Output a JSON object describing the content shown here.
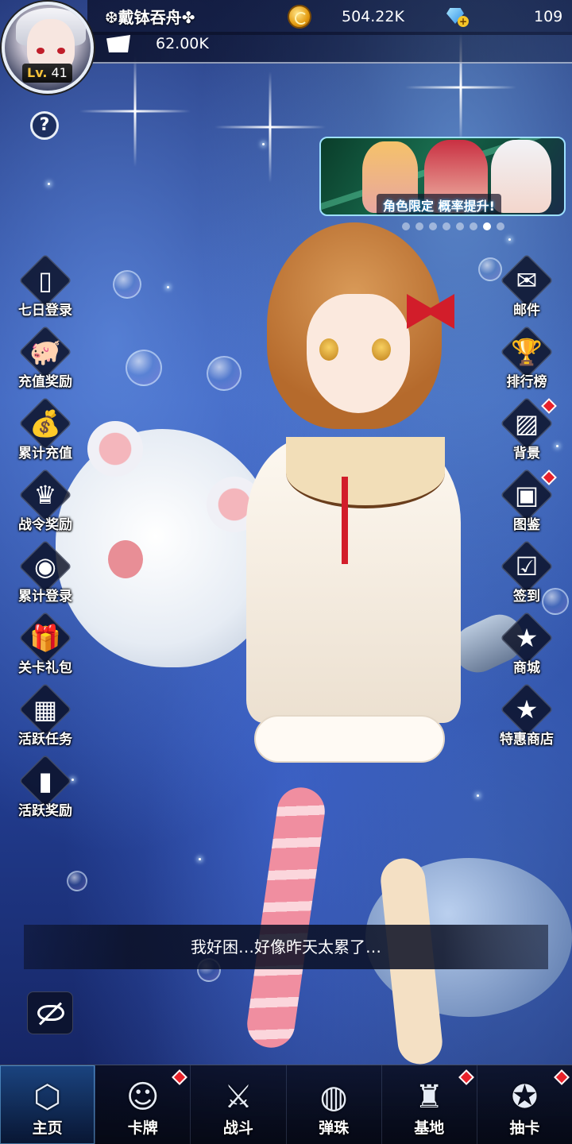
{
  "player": {
    "name": "❆戴钵吞舟✤",
    "level_prefix": "Lv.",
    "level": "41",
    "stamina": "62.00K"
  },
  "currency": {
    "coins": "504.22K",
    "gems": "109"
  },
  "help": {
    "label": "?"
  },
  "banner": {
    "text": "角色限定 概率提升!",
    "page_count": 8,
    "active_page": 7
  },
  "left_menu": [
    {
      "label": "七日登录",
      "icon": "phone-check-icon"
    },
    {
      "label": "充值奖励",
      "icon": "piggy-bank-icon"
    },
    {
      "label": "累计充值",
      "icon": "money-bag-icon"
    },
    {
      "label": "战令奖励",
      "icon": "crown-icon"
    },
    {
      "label": "累计登录",
      "icon": "user-check-icon"
    },
    {
      "label": "关卡礼包",
      "icon": "gift-box-icon"
    },
    {
      "label": "活跃任务",
      "icon": "calendar-icon"
    },
    {
      "label": "活跃奖励",
      "icon": "bar-star-icon"
    }
  ],
  "right_menu": [
    {
      "label": "邮件",
      "icon": "mail-icon",
      "alert": false
    },
    {
      "label": "排行榜",
      "icon": "trophy-icon",
      "alert": false
    },
    {
      "label": "背景",
      "icon": "image-icon",
      "alert": true
    },
    {
      "label": "图鉴",
      "icon": "portrait-book-icon",
      "alert": true
    },
    {
      "label": "签到",
      "icon": "calendar-check-icon",
      "alert": false
    },
    {
      "label": "商城",
      "icon": "shop-basket-icon",
      "alert": false
    },
    {
      "label": "特惠商店",
      "icon": "store-star-icon",
      "alert": false
    }
  ],
  "dialog": {
    "text": "我好困…好像昨天太累了…"
  },
  "bottom_nav": [
    {
      "label": "主页",
      "icon": "home-shield-icon",
      "active": true,
      "alert": false
    },
    {
      "label": "卡牌",
      "icon": "bunny-character-icon",
      "active": false,
      "alert": true
    },
    {
      "label": "战斗",
      "icon": "crossed-swords-icon",
      "active": false,
      "alert": false
    },
    {
      "label": "弹珠",
      "icon": "robot-head-icon",
      "active": false,
      "alert": false
    },
    {
      "label": "基地",
      "icon": "tower-icon",
      "active": false,
      "alert": true
    },
    {
      "label": "抽卡",
      "icon": "summon-badge-icon",
      "active": false,
      "alert": true
    }
  ],
  "colors": {
    "background": "#2e4fa8",
    "gold": "#f5c23a",
    "alert": "#e8212a",
    "active_tab": "#286ec8"
  }
}
